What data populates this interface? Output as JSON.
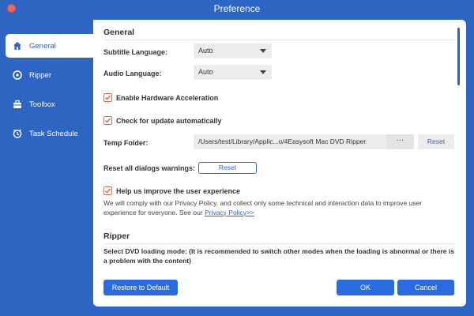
{
  "window": {
    "title": "Preference"
  },
  "sidebar": {
    "items": [
      {
        "label": "General",
        "icon": "home-icon",
        "active": true
      },
      {
        "label": "Ripper",
        "icon": "disc-icon",
        "active": false
      },
      {
        "label": "Toolbox",
        "icon": "toolbox-icon",
        "active": false
      },
      {
        "label": "Task Schedule",
        "icon": "clock-icon",
        "active": false
      }
    ]
  },
  "general": {
    "section_title": "General",
    "subtitle_language": {
      "label": "Subtitle Language:",
      "value": "Auto"
    },
    "audio_language": {
      "label": "Audio Language:",
      "value": "Auto"
    },
    "hardware_acceleration": {
      "label": "Enable Hardware Acceleration",
      "checked": true
    },
    "check_update": {
      "label": "Check for update automatically",
      "checked": true
    },
    "temp_folder": {
      "label": "Temp Folder:",
      "path": "/Users/test/Library/Applic...o/4Easysoft Mac DVD Ripper",
      "browse_label": "···",
      "reset_label": "Reset"
    },
    "reset_dialogs": {
      "label": "Reset all dialogs warnings:",
      "button_label": "Reset"
    },
    "improve": {
      "label": "Help us improve the user experience",
      "checked": true,
      "description": "We will comply with our Privacy Policy, and collect only some technical and interaction data to improve user experience for everyone. See our ",
      "link_text": "Privacy Policy>>"
    }
  },
  "ripper": {
    "section_title": "Ripper",
    "loading_mode_text": "Select DVD loading mode: (It is recommended to switch other modes when the loading is abnormal or there is a problem with the content)"
  },
  "footer": {
    "restore_label": "Restore to Default",
    "ok_label": "OK",
    "cancel_label": "Cancel"
  },
  "colors": {
    "accent": "#2e64c2",
    "button_blue": "#2b6be0",
    "checkbox_orange": "#ec6b3f"
  }
}
